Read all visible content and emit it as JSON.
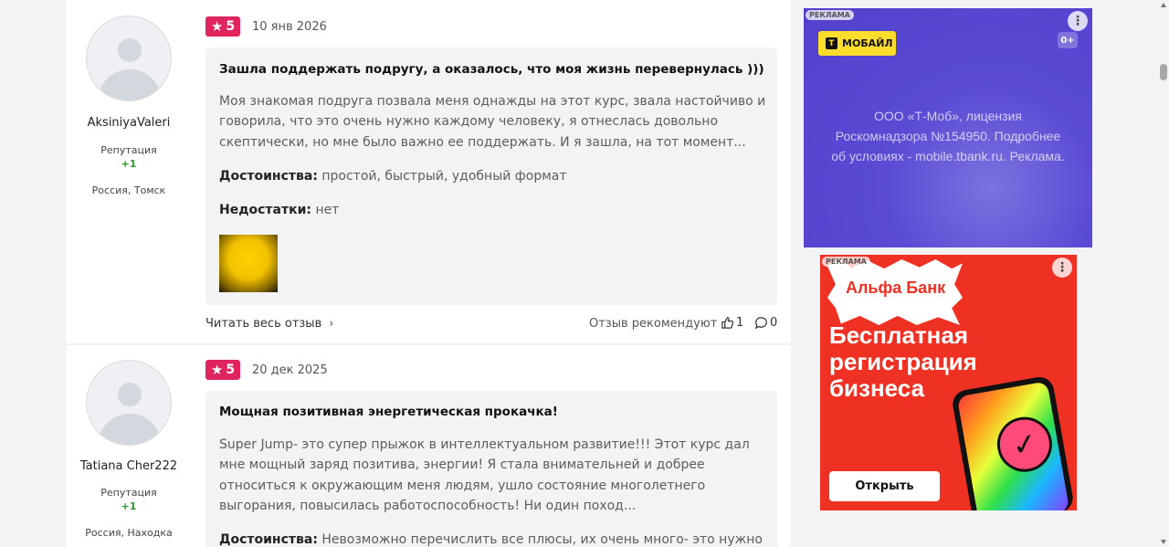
{
  "reviews": [
    {
      "user": {
        "name": "AksiniyaValeri",
        "reputation_label": "Репутация",
        "reputation_value": "+1",
        "location": "Россия, Томск"
      },
      "rating": "5",
      "date": "10 янв 2026",
      "title": "Зашла поддержать подругу, а оказалось, что моя жизнь перевернулась )))",
      "text": "Моя знакомая подруга позвала меня однажды на этот курс, звала настойчиво и говорила, что это очень нужно каждому человеку, я отнеслась довольно скептически, но мне было важно ее поддержать. И я зашла, на тот момент...",
      "pros_label": "Достоинства:",
      "pros": "простой, быстрый, удобный формат",
      "cons_label": "Недостатки:",
      "cons": "нет",
      "read_more": "Читать весь отзыв",
      "recommend": "Отзыв рекомендуют",
      "likes": "1",
      "comments": "0"
    },
    {
      "user": {
        "name": "Tatiana Cher222",
        "reputation_label": "Репутация",
        "reputation_value": "+1",
        "location": "Россия, Находка"
      },
      "rating": "5",
      "date": "20 дек 2025",
      "title": "Мощная позитивная энергетическая прокачка!",
      "text": "Super Jump- это супер прыжок в интеллектуальном развитие!!! Этот курс дал мне мощный заряд позитива, энергии! Я стала внимательней и добрее относиться к окружающим меня людям, ушло состояние многолетнего выгорания, повысилась работоспособность! Ни один поход...",
      "pros_label": "Достоинства:",
      "pros": "Невозможно перечислить все плюсы, их очень много- это нужно"
    }
  ],
  "ads": {
    "tmobile": {
      "label": "РЕКЛАМА",
      "brand": "МОБАЙЛ",
      "brand_letter": "Т",
      "age": "0+",
      "legal": "ООО «Т-Моб», лицензия Роскомнадзора №154950. Подробнее об условиях - mobile.tbank.ru. Реклама."
    },
    "alfa": {
      "label": "РЕКЛАМА",
      "brand": "Альфа Банк",
      "headline": "Бесплатная регистрация бизнеса",
      "button": "Открыть"
    }
  },
  "icons": {
    "star": "star-icon",
    "chevron": "chevron-right-icon",
    "like": "thumbs-up-icon",
    "comment": "comment-icon",
    "more": "more-vertical-icon",
    "check": "checkmark-icon"
  },
  "colors": {
    "rating_badge": "#e0245e",
    "reputation_positive": "#2a9a2a",
    "tmobile_bg": "#5140cd",
    "tmobile_yellow": "#ffdd2d",
    "alfa_red": "#ef3124"
  }
}
